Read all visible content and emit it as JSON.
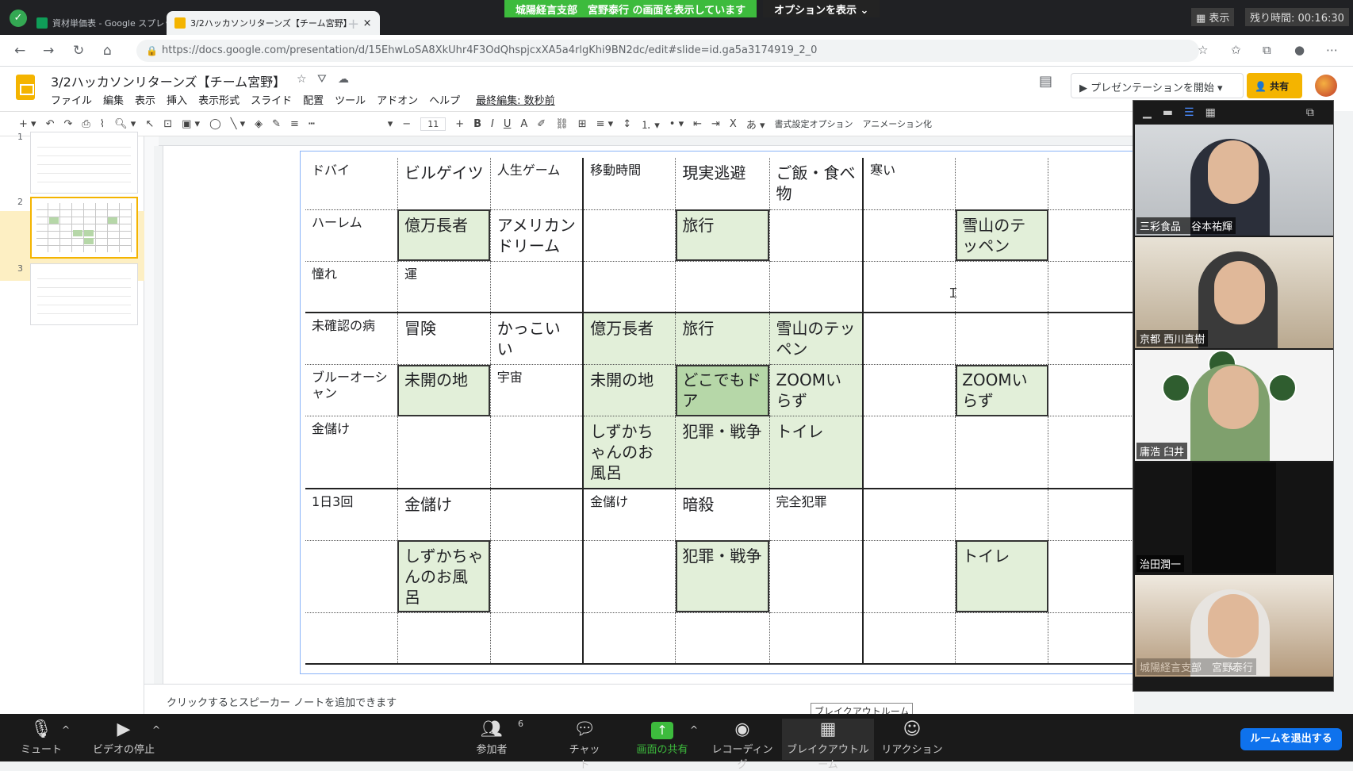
{
  "browser": {
    "tabs": [
      {
        "title": "資材単価表 - Google スプレッドシ…",
        "active": false
      },
      {
        "title": "3/2ハッカソンリターンズ【チーム宮野】",
        "active": true
      }
    ],
    "url": "https://docs.google.com/presentation/d/15EhwLoSA8XkUhr4F3OdQhspjcxXA5a4rlgKhi9BN2dc/edit#slide=id.ga5a3174919_2_0"
  },
  "zoom_banner": {
    "sharing_text": "城陽経言支部　宮野泰行 の画面を表示しています",
    "options_label": "オプションを表示",
    "view_label": "表示",
    "remaining": "残り時間: 00:16:30"
  },
  "slides_app": {
    "title": "3/2ハッカソンリターンズ【チーム宮野】",
    "menu": [
      "ファイル",
      "編集",
      "表示",
      "挿入",
      "表示形式",
      "スライド",
      "配置",
      "ツール",
      "アドオン",
      "ヘルプ"
    ],
    "last_edit": "最終編集: 数秒前",
    "present_label": "プレゼンテーションを開始",
    "share_label": "共有",
    "font_size": "11",
    "format_options": "書式設定オプション",
    "animation": "アニメーション化",
    "notes_placeholder": "クリックするとスピーカー ノートを追加できます",
    "slide_numbers": [
      "1",
      "2",
      "3"
    ]
  },
  "table_rows": [
    [
      {
        "t": "ドバイ",
        "s": 1
      },
      {
        "t": "ビルゲイツ"
      },
      {
        "t": "人生ゲーム",
        "s": 1
      },
      {
        "t": "移動時間",
        "s": 1
      },
      {
        "t": "現実逃避"
      },
      {
        "t": "ご飯・食べ物"
      },
      {
        "t": "寒い",
        "s": 1
      },
      {
        "t": ""
      },
      {
        "t": ""
      }
    ],
    [
      {
        "t": "ハーレム",
        "s": 1
      },
      {
        "t": "億万長者",
        "g": 1,
        "b": 1
      },
      {
        "t": "アメリカンドリーム"
      },
      {
        "t": ""
      },
      {
        "t": "旅行",
        "g": 1,
        "b": 1
      },
      {
        "t": ""
      },
      {
        "t": ""
      },
      {
        "t": "雪山のテッペン",
        "g": 1,
        "b": 1
      },
      {
        "t": ""
      }
    ],
    [
      {
        "t": "憧れ",
        "s": 1
      },
      {
        "t": "運",
        "s": 1
      },
      {
        "t": ""
      },
      {
        "t": ""
      },
      {
        "t": ""
      },
      {
        "t": ""
      },
      {
        "t": ""
      },
      {
        "t": ""
      },
      {
        "t": ""
      }
    ],
    [
      {
        "t": "未確認の病",
        "s": 1
      },
      {
        "t": "冒険"
      },
      {
        "t": "かっこいい"
      },
      {
        "t": "億万長者",
        "g": 1
      },
      {
        "t": "旅行",
        "g": 1
      },
      {
        "t": "雪山のテッペン",
        "g": 1
      },
      {
        "t": ""
      },
      {
        "t": ""
      },
      {
        "t": ""
      }
    ],
    [
      {
        "t": "ブルーオーシャン",
        "s": 1
      },
      {
        "t": "未開の地",
        "g": 1,
        "b": 1
      },
      {
        "t": "宇宙",
        "s": 1
      },
      {
        "t": "未開の地",
        "g": 1
      },
      {
        "t": "どこでもドア",
        "g": 1,
        "b": 1,
        "d": 1
      },
      {
        "t": "ZOOMいらず",
        "g": 1
      },
      {
        "t": ""
      },
      {
        "t": "ZOOMいらず",
        "g": 1,
        "b": 1
      },
      {
        "t": ""
      }
    ],
    [
      {
        "t": "金儲け",
        "s": 1
      },
      {
        "t": ""
      },
      {
        "t": ""
      },
      {
        "t": "しずかちゃんのお風呂",
        "g": 1
      },
      {
        "t": "犯罪・戦争",
        "g": 1
      },
      {
        "t": "トイレ",
        "g": 1
      },
      {
        "t": ""
      },
      {
        "t": ""
      },
      {
        "t": ""
      }
    ],
    [
      {
        "t": "1日3回",
        "s": 1
      },
      {
        "t": "金儲け"
      },
      {
        "t": ""
      },
      {
        "t": "金儲け",
        "s": 1
      },
      {
        "t": "暗殺"
      },
      {
        "t": "完全犯罪",
        "s": 1
      },
      {
        "t": ""
      },
      {
        "t": ""
      },
      {
        "t": ""
      }
    ],
    [
      {
        "t": ""
      },
      {
        "t": "しずかちゃんのお風呂",
        "g": 1,
        "b": 1
      },
      {
        "t": ""
      },
      {
        "t": ""
      },
      {
        "t": "犯罪・戦争",
        "g": 1,
        "b": 1
      },
      {
        "t": ""
      },
      {
        "t": ""
      },
      {
        "t": "トイレ",
        "g": 1,
        "b": 1
      },
      {
        "t": ""
      }
    ],
    [
      {
        "t": ""
      },
      {
        "t": ""
      },
      {
        "t": ""
      },
      {
        "t": ""
      },
      {
        "t": ""
      },
      {
        "t": ""
      },
      {
        "t": ""
      },
      {
        "t": ""
      },
      {
        "t": ""
      }
    ]
  ],
  "participants": [
    {
      "name": "三彩食品　谷本祐輝"
    },
    {
      "name": "京都 西川直樹"
    },
    {
      "name": "庸浩 臼井"
    },
    {
      "name": "治田潤一"
    },
    {
      "name": "城陽経言支部　宮野泰行"
    }
  ],
  "zoom_toolbar": {
    "mute": "ミュート",
    "video": "ビデオの停止",
    "participants": "参加者",
    "participant_count": "6",
    "chat": "チャット",
    "share": "画面の共有",
    "record": "レコーディング",
    "breakout": "ブレイクアウトルーム",
    "breakout_tooltip": "ブレイクアウトルーム",
    "reactions": "リアクション",
    "leave": "ルームを退出する"
  },
  "colors": {
    "accent_green": "#3dbb3d",
    "slides_yellow": "#f4b400",
    "cell_green": "#e2efd9",
    "zoom_blue": "#0e72ed"
  }
}
